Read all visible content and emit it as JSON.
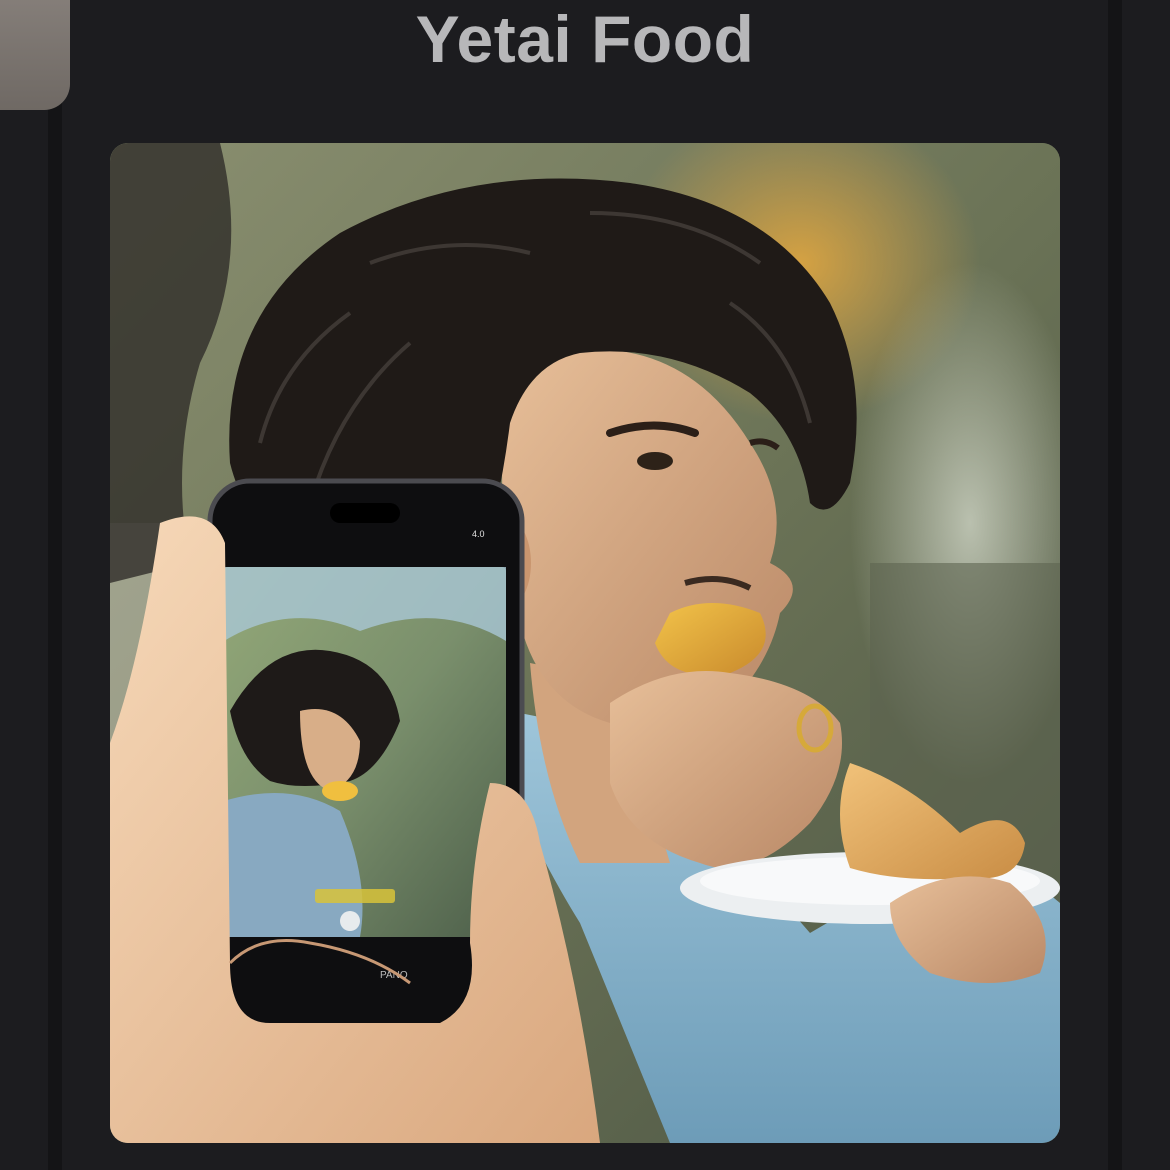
{
  "header": {
    "title": "Yetai Food"
  },
  "post": {
    "image_description_icon": "photo-image",
    "phone_screen": {
      "mode_label": "PANO",
      "zoom_label": "4.0"
    }
  },
  "colors": {
    "background": "#1c1c1f",
    "title_text": "#b7b7b9",
    "tab": "#7d7772"
  }
}
